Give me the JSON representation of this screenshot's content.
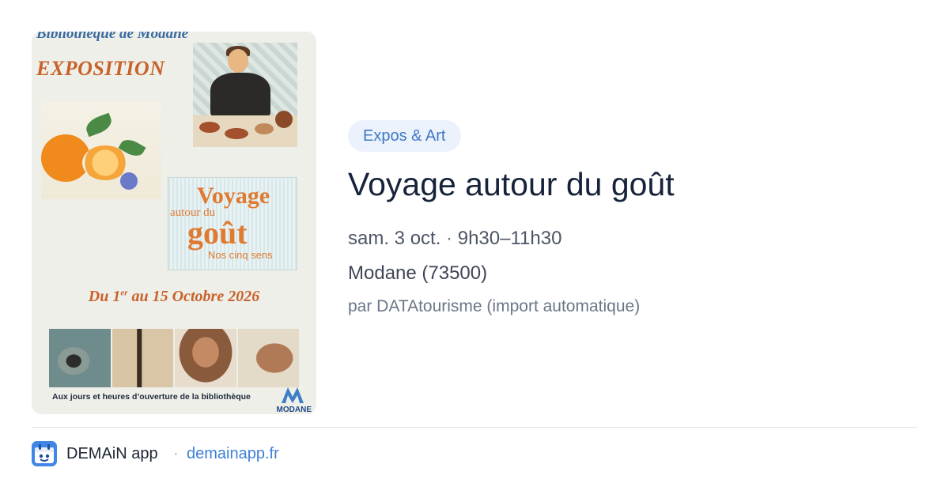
{
  "poster": {
    "library": "Bibliothèque de Modane",
    "heading": "EXPOSITION",
    "title_line1": "Voyage",
    "title_line2": "autour du",
    "title_line3": "goût",
    "title_line4": "Nos cinq sens",
    "dates_prefix": "Du 1",
    "dates_sup": "er",
    "dates_suffix": " au 15 Octobre  2026",
    "footer": "Aux jours et heures d’ouverture de la bibliothèque",
    "logo_text": "MODANE"
  },
  "event": {
    "category": "Expos & Art",
    "title": "Voyage autour du goût",
    "date": "sam. 3 oct.",
    "separator": "·",
    "time": "9h30–11h30",
    "location": "Modane (73500)",
    "source": "par DATAtourisme (import automatique)"
  },
  "footer": {
    "app_name": "DEMAiN app",
    "separator": "·",
    "url": "demainapp.fr",
    "icon": "demain-app-icon"
  },
  "colors": {
    "badge_bg": "#ebf2fc",
    "badge_text": "#3f78c4",
    "title": "#16233a",
    "link": "#3f80d8",
    "poster_orange": "#c8622a"
  }
}
